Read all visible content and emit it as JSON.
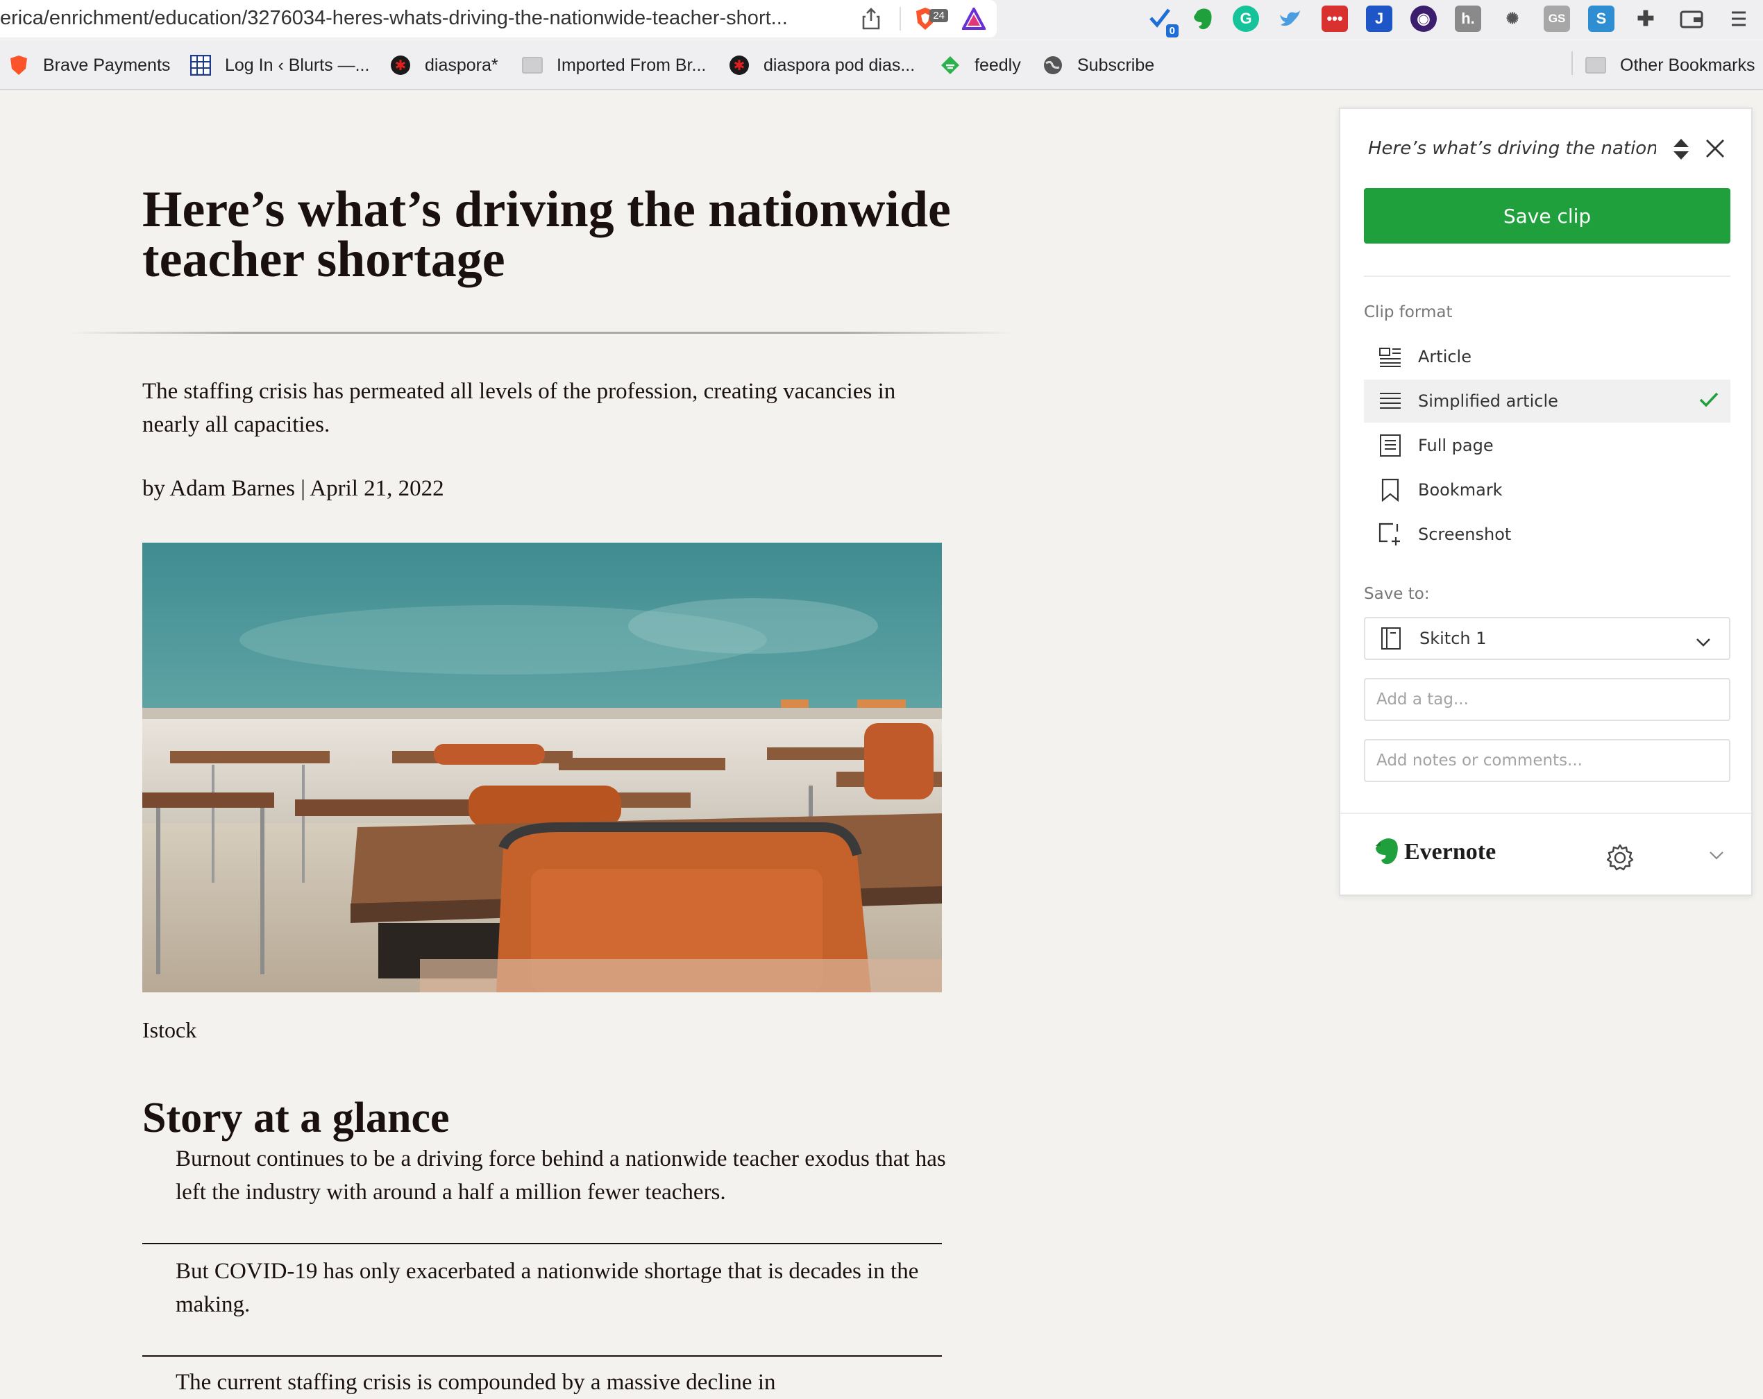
{
  "browser": {
    "url": "erica/enrichment/education/3276034-heres-whats-driving-the-nationwide-teacher-short...",
    "brave_badge": "24",
    "ext_badge": "0"
  },
  "bookmarks": [
    {
      "label": "Brave Payments",
      "icon": "brave-lion-icon"
    },
    {
      "label": "Log In ‹ Blurts —...",
      "icon": "grid-icon"
    },
    {
      "label": "diaspora*",
      "icon": "diaspora-icon"
    },
    {
      "label": "Imported From Br...",
      "icon": "folder-icon"
    },
    {
      "label": "diaspora pod dias...",
      "icon": "diaspora-icon"
    },
    {
      "label": "feedly",
      "icon": "feedly-icon"
    },
    {
      "label": "Subscribe",
      "icon": "globe-icon"
    }
  ],
  "other_bookmarks": "Other Bookmarks",
  "article": {
    "headline": "Here’s what’s driving the nationwide teacher shortage",
    "dek": "The staffing crisis has permeated all levels of the profession, creating vacancies in nearly all capacities.",
    "byline": "by Adam Barnes | April 21, 2022",
    "caption": "Istock",
    "glance_title": "Story at a glance",
    "glance_items": [
      "Burnout continues to be a driving force behind a nationwide teacher exodus that has left the industry with around a half a million fewer teachers.",
      "But COVID-19 has only exacerbated a nationwide shortage that is decades in the making.",
      "The current staffing crisis is compounded by a massive decline in"
    ]
  },
  "clipper": {
    "title": "Here’s what’s driving the nationwide teacher shortage",
    "save_label": "Save clip",
    "clip_format_label": "Clip format",
    "formats": [
      {
        "label": "Article",
        "icon": "article-icon"
      },
      {
        "label": "Simplified article",
        "icon": "simplified-article-icon",
        "selected": true
      },
      {
        "label": "Full page",
        "icon": "full-page-icon"
      },
      {
        "label": "Bookmark",
        "icon": "bookmark-icon"
      },
      {
        "label": "Screenshot",
        "icon": "screenshot-icon"
      }
    ],
    "save_to_label": "Save to:",
    "notebook": "Skitch 1",
    "tag_placeholder": "Add a tag...",
    "notes_placeholder": "Add notes or comments...",
    "brand": "Evernote",
    "accent_color": "#20a03d"
  }
}
